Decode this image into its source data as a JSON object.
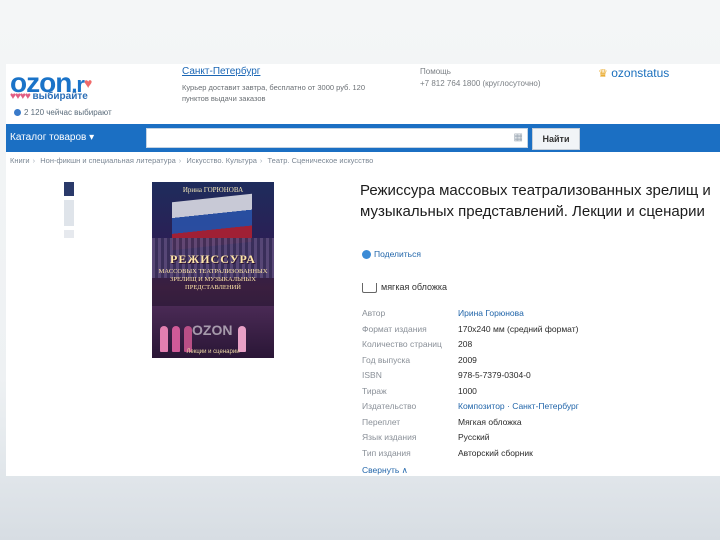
{
  "header": {
    "logo_text": "ozon",
    "logo_suffix": ".r",
    "tagline_hearts": "♥♥♥♥",
    "tagline": "выбирайте",
    "buyers": "2 120 чейчас выбирают",
    "city": "Санкт-Петербург",
    "delivery": "Курьер доставит завтра, бесплатно от 3000 руб. 120 пунктов выдачи заказов",
    "help_title": "Помощь",
    "help_phone": "+7 812 764 1800 (круглосуточно)",
    "status_text": "ozonstatus"
  },
  "nav": {
    "catalog_label": "Каталог товаров ▾",
    "search_placeholder": "",
    "find_label": "Найти"
  },
  "breadcrumb": [
    "Книги",
    "Нон-фикшн и специальная литература",
    "Искусство. Культура",
    "Театр. Сценическое искусство"
  ],
  "cover": {
    "author": "Ирина ГОРЮНОВА",
    "title_main": "РЕЖИССУРА",
    "title_sub": "МАССОВЫХ ТЕАТРАЛИЗОВАННЫХ ЗРЕЛИЩ И МУЗЫКАЛЬНЫХ ПРЕДСТАВЛЕНИЙ",
    "watermark": "OZON",
    "publisher": "Лекции и сценарии"
  },
  "product": {
    "title": "Режиссура массовых театрализованных зрелищ и музыкальных представлений. Лекции и сценарии",
    "share_label": "Поделиться",
    "binding": "мягкая обложка",
    "specs": [
      {
        "key": "Автор",
        "value": "Ирина Горюнова",
        "link": true
      },
      {
        "key": "Формат издания",
        "value": "170x240 мм (средний формат)",
        "link": false
      },
      {
        "key": "Количество страниц",
        "value": "208",
        "link": false
      },
      {
        "key": "Год выпуска",
        "value": "2009",
        "link": false
      },
      {
        "key": "ISBN",
        "value": "978-5-7379-0304-0",
        "link": false
      },
      {
        "key": "Тираж",
        "value": "1000",
        "link": false
      },
      {
        "key": "Издательство",
        "value": "Композитор · Санкт-Петербург",
        "link": true
      },
      {
        "key": "Переплет",
        "value": "Мягкая обложка",
        "link": false
      },
      {
        "key": "Язык издания",
        "value": "Русский",
        "link": false
      },
      {
        "key": "Тип издания",
        "value": "Авторский сборник",
        "link": false
      }
    ],
    "collapse_label": "Свернуть ∧"
  },
  "colors": {
    "accent": "#1b6fc3",
    "link": "#2266aa",
    "status_crown": "#e8a41e"
  }
}
